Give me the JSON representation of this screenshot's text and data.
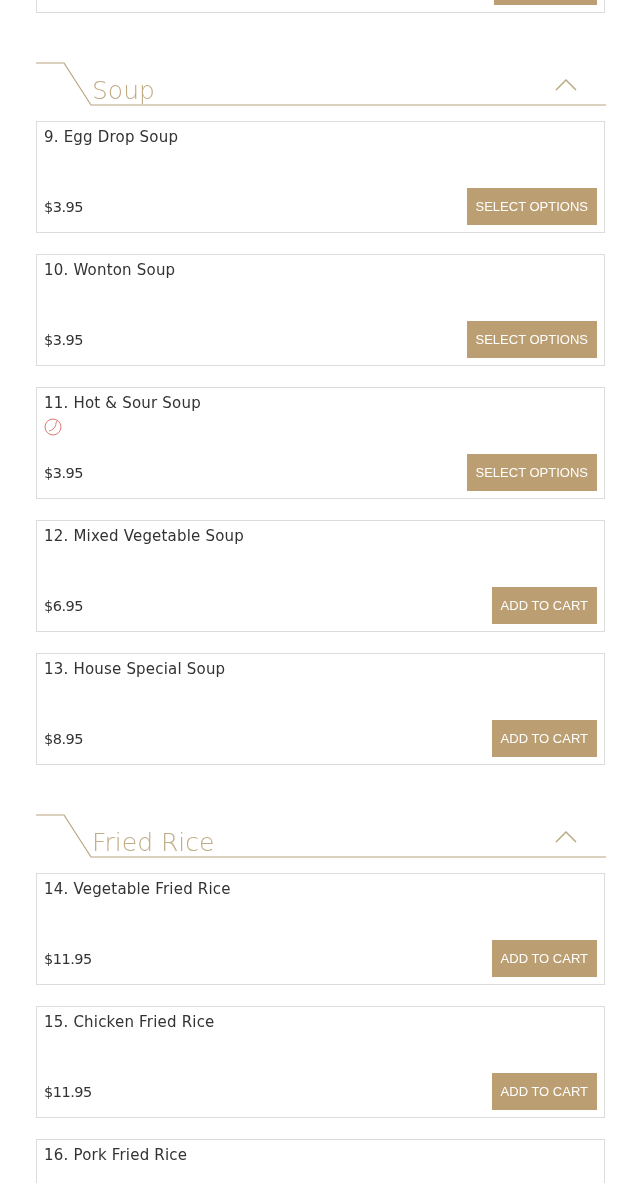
{
  "sections": [
    {
      "title": "Soup",
      "expanded": true,
      "items": [
        {
          "name": "9. Egg Drop Soup",
          "spicy": false,
          "price": "$3.95",
          "button": "SELECT OPTIONS"
        },
        {
          "name": "10. Wonton Soup",
          "spicy": false,
          "price": "$3.95",
          "button": "SELECT OPTIONS"
        },
        {
          "name": "11. Hot & Sour Soup",
          "spicy": true,
          "price": "$3.95",
          "button": "SELECT OPTIONS"
        },
        {
          "name": "12. Mixed Vegetable Soup",
          "spicy": false,
          "price": "$6.95",
          "button": "ADD TO CART"
        },
        {
          "name": "13. House Special Soup",
          "spicy": false,
          "price": "$8.95",
          "button": "ADD TO CART"
        }
      ]
    },
    {
      "title": "Fried Rice",
      "expanded": true,
      "items": [
        {
          "name": "14. Vegetable Fried Rice",
          "spicy": false,
          "price": "$11.95",
          "button": "ADD TO CART"
        },
        {
          "name": "15. Chicken Fried Rice",
          "spicy": false,
          "price": "$11.95",
          "button": "ADD TO CART"
        },
        {
          "name": "16. Pork Fried Rice",
          "spicy": false
        }
      ]
    }
  ]
}
